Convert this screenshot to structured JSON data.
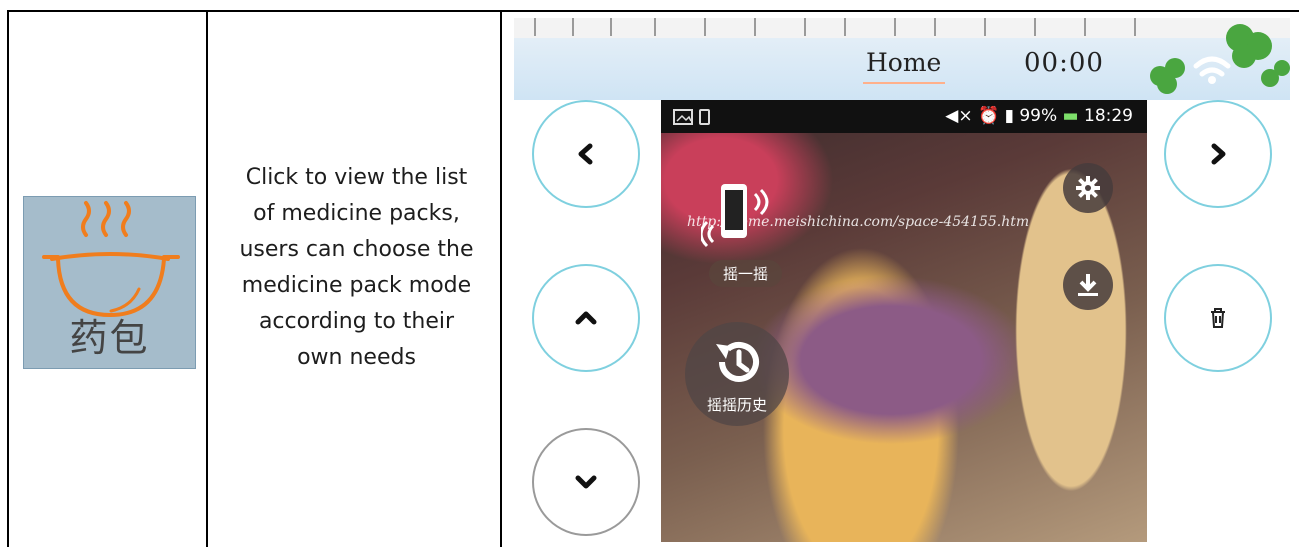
{
  "row": {
    "icon_label": "药包",
    "description_lines": [
      "Click to view the list",
      "of medicine packs,",
      "users can choose the",
      "medicine pack mode",
      "according to their",
      "own needs"
    ]
  },
  "device": {
    "header": {
      "title": "Home",
      "time": "00:00"
    },
    "statusbar": {
      "battery": "99%",
      "clock": "18:29"
    },
    "photo": {
      "watermark_url": "http://home.meishichina.com/space-454155.htm",
      "shake_label": "摇一摇",
      "history_label": "摇摇历史"
    },
    "nav": {
      "left_icon": "chevron-left-icon",
      "up_icon": "chevron-up-icon",
      "down_icon": "chevron-down-icon",
      "right_icon": "chevron-right-icon",
      "delete_icon": "trash-icon",
      "settings_icon": "gear-icon",
      "download_icon": "download-icon"
    }
  },
  "colors": {
    "button_border": "#7fd0df",
    "icon_tile": "#a5bccb",
    "home_underline": "#ffb08a"
  }
}
